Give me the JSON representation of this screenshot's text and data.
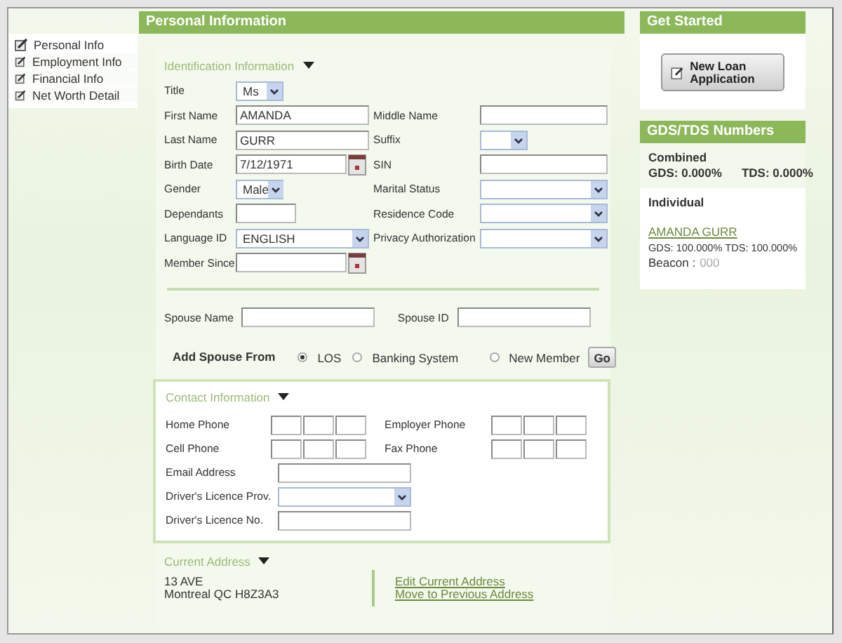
{
  "sidebar": {
    "items": [
      {
        "label": "Personal Info",
        "selected": true
      },
      {
        "label": "Employment Info",
        "selected": false
      },
      {
        "label": "Financial Info",
        "selected": false
      },
      {
        "label": "Net Worth Detail",
        "selected": false
      }
    ]
  },
  "main": {
    "title": "Personal Information",
    "identification": {
      "title": "Identification Information",
      "rows": [
        {
          "left": {
            "label": "Title",
            "kind": "select",
            "value": "Ms"
          }
        },
        {
          "left": {
            "label": "First Name",
            "kind": "text",
            "value": "AMANDA"
          },
          "right": {
            "label": "Middle Name",
            "kind": "text"
          }
        },
        {
          "left": {
            "label": "Last Name",
            "kind": "text",
            "value": "GURR"
          },
          "right": {
            "label": "Suffix",
            "kind": "select"
          }
        },
        {
          "left": {
            "label": "Birth Date",
            "kind": "date",
            "value": "7/12/1971"
          },
          "right": {
            "label": "SIN",
            "kind": "text"
          }
        },
        {
          "left": {
            "label": "Gender",
            "kind": "select",
            "value": "Male"
          },
          "right": {
            "label": "Marital Status",
            "kind": "select"
          }
        },
        {
          "left": {
            "label": "Dependants",
            "kind": "text"
          },
          "right": {
            "label": "Residence Code",
            "kind": "select"
          }
        },
        {
          "left": {
            "label": "Language ID",
            "kind": "select",
            "value": "ENGLISH"
          },
          "right": {
            "label": "Privacy Authorization",
            "kind": "select"
          }
        },
        {
          "left": {
            "label": "Member Since",
            "kind": "date"
          }
        }
      ]
    },
    "spouse": {
      "fields": [
        {
          "label": "Spouse Name"
        },
        {
          "label": "Spouse ID"
        }
      ],
      "add_from": {
        "label": "Add Spouse From",
        "options": [
          {
            "label": "LOS",
            "selected": true
          },
          {
            "label": "Banking System",
            "selected": false
          },
          {
            "label": "New Member",
            "selected": false
          }
        ],
        "button": "Go"
      }
    },
    "contact": {
      "title": "Contact Information",
      "phones": [
        {
          "label": "Home Phone"
        },
        {
          "label": "Employer Phone"
        },
        {
          "label": "Cell Phone"
        },
        {
          "label": "Fax Phone"
        }
      ],
      "fields": [
        {
          "label": "Email Address",
          "kind": "text"
        },
        {
          "label": "Driver's Licence Prov.",
          "kind": "select"
        },
        {
          "label": "Driver's Licence No.",
          "kind": "text"
        }
      ]
    },
    "address": {
      "title": "Current Address",
      "lines": [
        "13 AVE",
        "Montreal QC H8Z3A3"
      ],
      "links": [
        "Edit Current Address",
        "Move to Previous Address"
      ]
    }
  },
  "right": {
    "get_started": {
      "title": "Get Started",
      "button": "New Loan Application"
    },
    "numbers": {
      "title": "GDS/TDS Numbers",
      "combined": {
        "label": "Combined",
        "gds": "GDS: 0.000%",
        "tds": "TDS: 0.000%"
      },
      "individual": {
        "label": "Individual",
        "name": "AMANDA GURR",
        "ratios": "GDS: 100.000% TDS: 100.000%",
        "beacon_label": "Beacon :",
        "beacon_value": "000"
      }
    }
  }
}
